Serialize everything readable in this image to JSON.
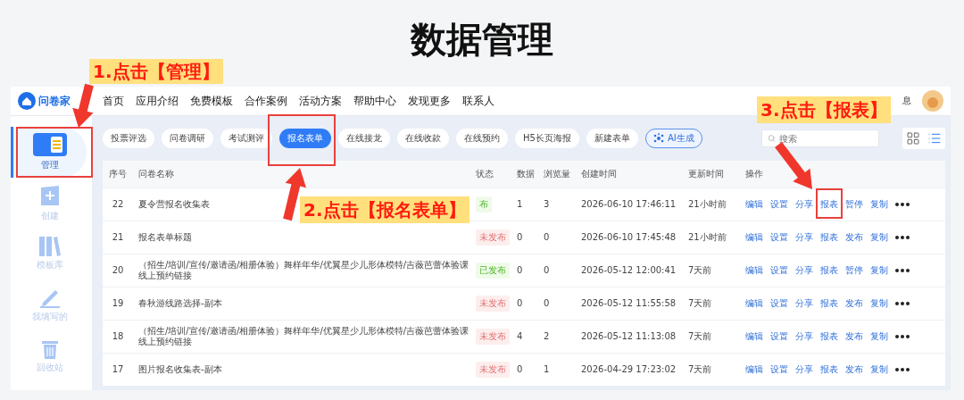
{
  "heading": "数据管理",
  "annotations": [
    {
      "label": "1.点击【管理】"
    },
    {
      "label": "2.点击【报名表单】"
    },
    {
      "label": "3.点击【报表】"
    }
  ],
  "logo": "问卷家",
  "nav": [
    "首页",
    "应用介绍",
    "免费模板",
    "合作案例",
    "活动方案",
    "帮助中心",
    "发现更多",
    "联系人"
  ],
  "messages": "息",
  "sidebar": [
    {
      "label": "管理",
      "kind": "manage",
      "selected": true
    },
    {
      "label": "创建",
      "kind": "create",
      "selected": false
    },
    {
      "label": "模板库",
      "kind": "library",
      "selected": false
    },
    {
      "label": "我填写的",
      "kind": "filled",
      "selected": false
    },
    {
      "label": "回收站",
      "kind": "trash",
      "selected": false
    }
  ],
  "chips": [
    {
      "label": "投票评选",
      "kind": "plain",
      "selected": false
    },
    {
      "label": "问卷调研",
      "kind": "plain",
      "selected": false
    },
    {
      "label": "考试测评",
      "kind": "plain",
      "selected": false
    },
    {
      "label": "报名表单",
      "kind": "plain",
      "selected": true
    },
    {
      "label": "在线接龙",
      "kind": "plain",
      "selected": false
    },
    {
      "label": "在线收款",
      "kind": "plain",
      "selected": false
    },
    {
      "label": "在线预约",
      "kind": "plain",
      "selected": false
    },
    {
      "label": "H5长页海报",
      "kind": "plain",
      "selected": false
    },
    {
      "label": "新建表单",
      "kind": "plain",
      "selected": false
    },
    {
      "label": "AI生成",
      "kind": "ai",
      "selected": false
    }
  ],
  "search": {
    "placeholder": "搜索"
  },
  "views": [
    {
      "kind": "grid",
      "selected": false
    },
    {
      "kind": "list",
      "selected": true
    }
  ],
  "table": {
    "columns": [
      "序号",
      "问卷名称",
      "状态",
      "数据",
      "浏览量",
      "创建时间",
      "更新时间",
      "操作"
    ],
    "rows": [
      {
        "id": "22",
        "name": "夏令营报名收集表",
        "status": "布",
        "published": true,
        "data": "1",
        "views": "3",
        "created": "2026-06-10 17:46:11",
        "updated": "21小时前",
        "actions": [
          "编辑",
          "设置",
          "分享",
          "报表",
          "暂停",
          "复制"
        ]
      },
      {
        "id": "21",
        "name": "报名表单标题",
        "status": "未发布",
        "published": false,
        "data": "0",
        "views": "0",
        "created": "2026-06-10 17:45:48",
        "updated": "21小时前",
        "actions": [
          "编辑",
          "设置",
          "分享",
          "报表",
          "发布",
          "复制"
        ]
      },
      {
        "id": "20",
        "name": "（招生/培训/宣传/邀请函/相册体验）舞样年华/优翼星少儿形体模特/吉薇芭蕾体验课线上预约链接",
        "status": "已发布",
        "published": true,
        "data": "0",
        "views": "0",
        "created": "2026-05-12 12:00:41",
        "updated": "7天前",
        "actions": [
          "编辑",
          "设置",
          "分享",
          "报表",
          "暂停",
          "复制"
        ]
      },
      {
        "id": "19",
        "name": "春秋游线路选择-副本",
        "status": "未发布",
        "published": false,
        "data": "0",
        "views": "0",
        "created": "2026-05-12 11:55:58",
        "updated": "7天前",
        "actions": [
          "编辑",
          "设置",
          "分享",
          "报表",
          "发布",
          "复制"
        ]
      },
      {
        "id": "18",
        "name": "（招生/培训/宣传/邀请函/相册体验）舞样年华/优翼星少儿形体模特/吉薇芭蕾体验课线上预约链接",
        "status": "未发布",
        "published": false,
        "data": "4",
        "views": "2",
        "created": "2026-05-12 11:13:08",
        "updated": "7天前",
        "actions": [
          "编辑",
          "设置",
          "分享",
          "报表",
          "发布",
          "复制"
        ]
      },
      {
        "id": "17",
        "name": "图片报名收集表-副本",
        "status": "未发布",
        "published": false,
        "data": "0",
        "views": "1",
        "created": "2026-04-29 17:23:02",
        "updated": "7天前",
        "actions": [
          "编辑",
          "设置",
          "分享",
          "报表",
          "发布",
          "复制"
        ]
      }
    ]
  }
}
